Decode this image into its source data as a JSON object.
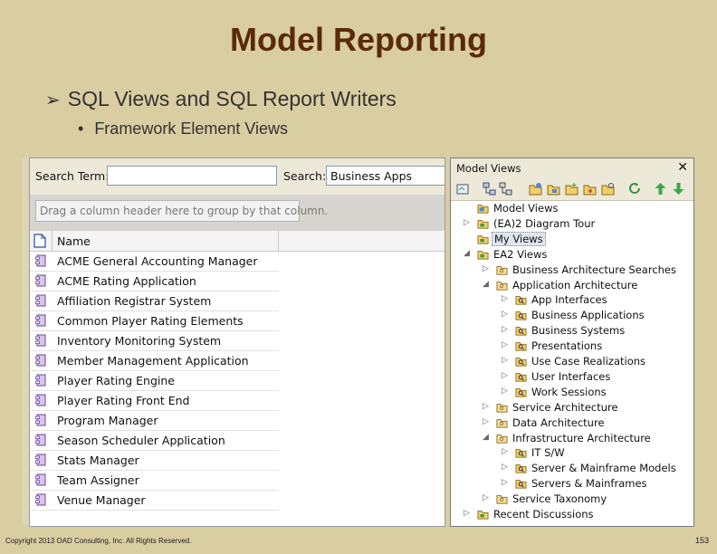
{
  "slide": {
    "title": "Model Reporting",
    "bullet1": "SQL Views and SQL Report Writers",
    "bullet2": "Framework Element Views",
    "footer": "Copyright 2013 OAD Consulting, Inc. All Rights Reserved.",
    "page_number": "153"
  },
  "search": {
    "term_label": "Search Term:",
    "term_value": "",
    "search_label": "Search:",
    "search_value": "Business Apps",
    "group_hint": "Drag a column header here to group by that column.",
    "column_name": "Name",
    "rows": [
      "ACME General Accounting Manager",
      "ACME Rating Application",
      "Affiliation Registrar System",
      "Common Player Rating Elements",
      "Inventory Monitoring System",
      "Member Management Application",
      "Player Rating Engine",
      "Player Rating Front End",
      "Program Manager",
      "Season Scheduler Application",
      "Stats Manager",
      "Team Assigner",
      "Venue Manager"
    ]
  },
  "tree": {
    "title": "Model Views",
    "close": "✕",
    "nodes": [
      {
        "label": "Model Views",
        "expander": "",
        "icon": "model-views-icon"
      },
      {
        "label": "(EA)2 Diagram Tour",
        "expander": "▷",
        "icon": "view-folder-icon"
      },
      {
        "label": "My Views",
        "expander": "",
        "icon": "view-folder-icon"
      },
      {
        "label": "EA2 Views",
        "expander": "◢",
        "icon": "view-folder-icon"
      },
      {
        "label": "Business Architecture Searches",
        "expander": "▷",
        "icon": "folder-icon"
      },
      {
        "label": "Application Architecture",
        "expander": "◢",
        "icon": "folder-icon"
      },
      {
        "label": "App Interfaces",
        "expander": "▷",
        "icon": "search-folder-icon"
      },
      {
        "label": "Business Applications",
        "expander": "▷",
        "icon": "search-folder-icon"
      },
      {
        "label": "Business Systems",
        "expander": "▷",
        "icon": "search-folder-icon"
      },
      {
        "label": "Presentations",
        "expander": "▷",
        "icon": "search-folder-icon"
      },
      {
        "label": "Use Case Realizations",
        "expander": "▷",
        "icon": "search-folder-icon"
      },
      {
        "label": "User Interfaces",
        "expander": "▷",
        "icon": "search-folder-icon"
      },
      {
        "label": "Work Sessions",
        "expander": "▷",
        "icon": "search-folder-icon"
      },
      {
        "label": "Service Architecture",
        "expander": "▷",
        "icon": "folder-icon"
      },
      {
        "label": "Data Architecture",
        "expander": "▷",
        "icon": "folder-icon"
      },
      {
        "label": "Infrastructure Architecture",
        "expander": "◢",
        "icon": "folder-icon"
      },
      {
        "label": "IT S/W",
        "expander": "▷",
        "icon": "search-folder-icon"
      },
      {
        "label": "Server & Mainframe Models",
        "expander": "▷",
        "icon": "search-folder-icon"
      },
      {
        "label": "Servers & Mainframes",
        "expander": "▷",
        "icon": "search-folder-icon"
      },
      {
        "label": "Service Taxonomy",
        "expander": "▷",
        "icon": "folder-icon"
      },
      {
        "label": "Recent Discussions",
        "expander": "▷",
        "icon": "view-folder-icon"
      }
    ]
  },
  "colors": {
    "background": "#d9cda2",
    "title": "#5a2a0a",
    "folder": "#f2cf6a",
    "element_icon": "#b58bd6"
  }
}
